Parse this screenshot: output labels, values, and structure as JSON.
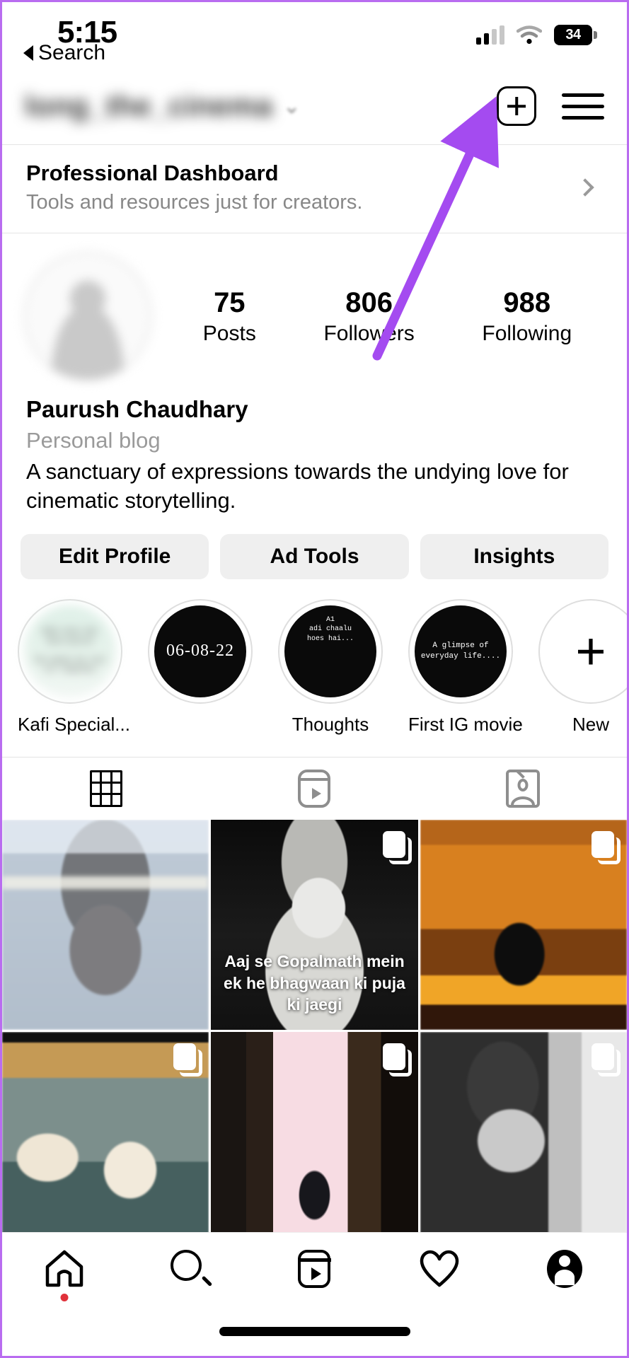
{
  "status_bar": {
    "time": "5:15",
    "back_label": "Search",
    "battery_level": "34",
    "icons": [
      "cellular-signal-icon",
      "wifi-icon",
      "battery-icon"
    ]
  },
  "header": {
    "username": "long_the_cinema",
    "username_blurred": true,
    "add_icon": "plus-square-icon",
    "menu_icon": "hamburger-menu-icon"
  },
  "professional_dashboard": {
    "title": "Professional Dashboard",
    "subtitle": "Tools and resources just for creators.",
    "chevron": "chevron-right-icon"
  },
  "profile": {
    "avatar": "profile-avatar",
    "stats": [
      {
        "value": "75",
        "label": "Posts"
      },
      {
        "value": "806",
        "label": "Followers"
      },
      {
        "value": "988",
        "label": "Following"
      }
    ],
    "display_name": "Paurush Chaudhary",
    "category": "Personal blog",
    "bio": "A sanctuary of expressions towards the undying love for cinematic storytelling."
  },
  "action_buttons": [
    {
      "label": "Edit Profile"
    },
    {
      "label": "Ad Tools"
    },
    {
      "label": "Insights"
    }
  ],
  "highlights": [
    {
      "label": "Kafi Special...",
      "thumb_text": "",
      "style": "mint"
    },
    {
      "label": "",
      "thumb_text": "06-08-22",
      "style": "date"
    },
    {
      "label": "Thoughts",
      "thumb_text": "A1\nadi chaalu\nhoes hai...",
      "style": "dark"
    },
    {
      "label": "First IG movie",
      "thumb_text": "A glimpse of everyday life....",
      "style": "dark"
    },
    {
      "label": "New",
      "thumb_text": "+",
      "style": "new"
    }
  ],
  "content_tabs": [
    {
      "name": "grid-tab",
      "icon": "grid-icon",
      "active": true
    },
    {
      "name": "reels-tab",
      "icon": "reels-icon",
      "active": false
    },
    {
      "name": "tagged-tab",
      "icon": "tagged-icon",
      "active": false
    }
  ],
  "posts": [
    {
      "id": 1,
      "carousel": false,
      "caption": ""
    },
    {
      "id": 2,
      "carousel": true,
      "caption": "Aaj se Gopalmath mein ek he bhagwaan ki puja ki jaegi"
    },
    {
      "id": 3,
      "carousel": true,
      "caption": ""
    },
    {
      "id": 4,
      "carousel": true,
      "caption": ""
    },
    {
      "id": 5,
      "carousel": true,
      "caption": ""
    },
    {
      "id": 6,
      "carousel": true,
      "caption": ""
    }
  ],
  "bottom_nav": [
    {
      "name": "home-tab",
      "icon": "home-icon",
      "badge": true
    },
    {
      "name": "search-tab",
      "icon": "search-icon",
      "badge": false
    },
    {
      "name": "reels-tab",
      "icon": "reels-icon",
      "badge": false
    },
    {
      "name": "activity-tab",
      "icon": "heart-icon",
      "badge": false
    },
    {
      "name": "profile-tab",
      "icon": "profile-avatar-icon",
      "badge": false
    }
  ],
  "annotation": {
    "type": "arrow",
    "color": "#a44bf0",
    "points_to": "hamburger-menu-icon"
  }
}
